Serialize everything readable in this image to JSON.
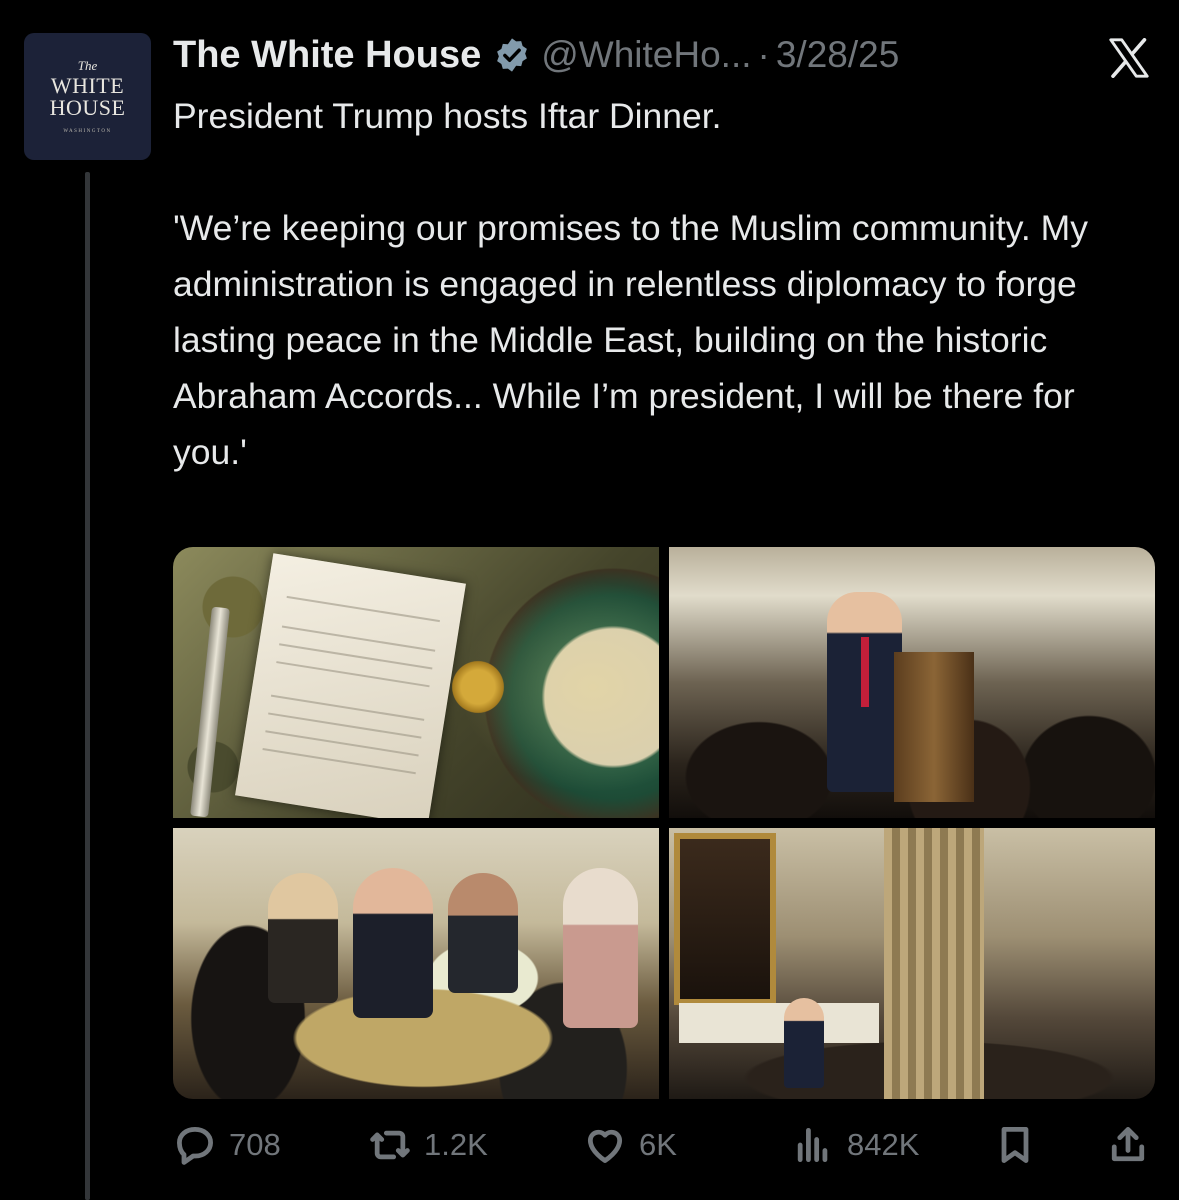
{
  "avatar": {
    "line1": "The",
    "line2": "WHITE",
    "line3": "HOUSE",
    "line4": "WASHINGTON"
  },
  "tweet": {
    "author_name": "The White House",
    "handle": "@WhiteHo...",
    "separator": "·",
    "date": "3/28/25",
    "text_line1": "President Trump hosts Iftar Dinner.",
    "text_quote": "'We’re keeping our promises to the Muslim community. My administration is engaged in relentless diplomacy to forge lasting peace in the Middle East, building on the historic Abraham Accords... While I’m president, I will be there for you.'"
  },
  "metrics": {
    "replies": "708",
    "reposts": "1.2K",
    "likes": "6K",
    "views": "842K"
  },
  "icons": {
    "verified": "verified-badge-icon",
    "brand": "x-logo-icon",
    "reply": "reply-icon",
    "repost": "repost-icon",
    "like": "heart-icon",
    "views": "analytics-icon",
    "bookmark": "bookmark-icon",
    "share": "share-icon"
  },
  "colors": {
    "background": "#000000",
    "text": "#e7e9ea",
    "muted": "#71767b",
    "verified": "#829aab"
  }
}
